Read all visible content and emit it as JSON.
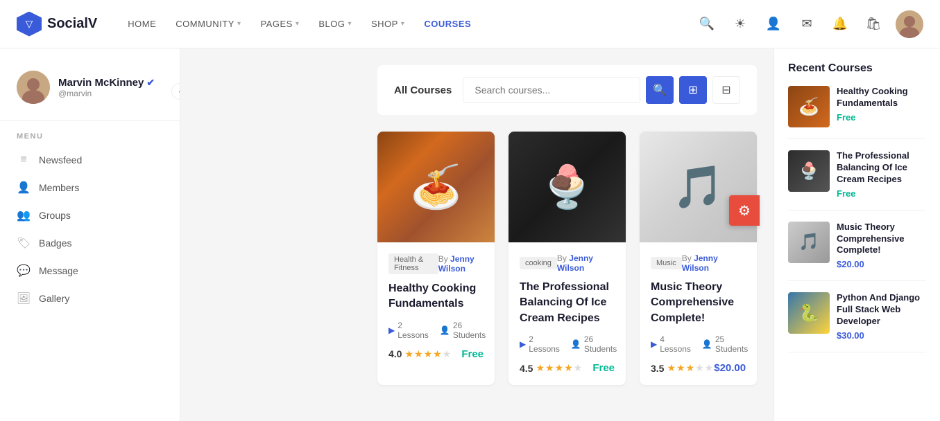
{
  "brand": {
    "name": "SocialV"
  },
  "nav": {
    "links": [
      {
        "id": "home",
        "label": "HOME",
        "active": false,
        "hasDropdown": false
      },
      {
        "id": "community",
        "label": "COMMUNITY",
        "active": false,
        "hasDropdown": true
      },
      {
        "id": "pages",
        "label": "PAGES",
        "active": false,
        "hasDropdown": true
      },
      {
        "id": "blog",
        "label": "BLOG",
        "active": false,
        "hasDropdown": true
      },
      {
        "id": "shop",
        "label": "SHOP",
        "active": false,
        "hasDropdown": true
      },
      {
        "id": "courses",
        "label": "COURSES",
        "active": true,
        "hasDropdown": false
      }
    ]
  },
  "user": {
    "name": "Marvin McKinney",
    "handle": "@marvin",
    "verified": true
  },
  "menu": {
    "label": "MENU",
    "items": [
      {
        "id": "newsfeed",
        "label": "Newsfeed",
        "icon": "≡"
      },
      {
        "id": "members",
        "label": "Members",
        "icon": "👤"
      },
      {
        "id": "groups",
        "label": "Groups",
        "icon": "👥"
      },
      {
        "id": "badges",
        "label": "Badges",
        "icon": "🏷"
      },
      {
        "id": "message",
        "label": "Message",
        "icon": "💬"
      },
      {
        "id": "gallery",
        "label": "Gallery",
        "icon": "🖼"
      }
    ]
  },
  "courses_page": {
    "header": {
      "all_courses_label": "All Courses",
      "search_placeholder": "Search courses...",
      "search_btn_label": "🔍",
      "grid_btn_label": "⊞",
      "filter_btn_label": "⊟"
    },
    "courses": [
      {
        "id": "course-1",
        "tag": "Health & Fitness",
        "author": "Jenny Wilson",
        "title": "Healthy Cooking Fundamentals",
        "lessons": "2 Lessons",
        "students": "26 Students",
        "rating": "4.0",
        "stars": "4",
        "price_label": "Free",
        "price_type": "free",
        "thumb_type": "pasta"
      },
      {
        "id": "course-2",
        "tag": "cooking",
        "author": "Jenny Wilson",
        "title": "The Professional Balancing Of Ice Cream Recipes",
        "lessons": "2 Lessons",
        "students": "26 Students",
        "rating": "4.5",
        "stars": "4.5",
        "price_label": "Free",
        "price_type": "free",
        "thumb_type": "icecream"
      },
      {
        "id": "course-3",
        "tag": "Music",
        "author": "Jenny Wilson",
        "title": "Music Theory Comprehensive Complete!",
        "lessons": "4 Lessons",
        "students": "25 Students",
        "rating": "3.5",
        "stars": "3.5",
        "price_label": "$20.00",
        "price_type": "paid",
        "thumb_type": "music"
      }
    ]
  },
  "recent_courses": {
    "title": "Recent Courses",
    "items": [
      {
        "id": "rc-1",
        "name": "Healthy Cooking Fundamentals",
        "price_label": "Free",
        "price_type": "free",
        "thumb_type": "pasta"
      },
      {
        "id": "rc-2",
        "name": "The Professional Balancing Of Ice Cream Recipes",
        "price_label": "Free",
        "price_type": "free",
        "thumb_type": "icecream"
      },
      {
        "id": "rc-3",
        "name": "Music Theory Comprehensive Complete!",
        "price_label": "$20.00",
        "price_type": "paid",
        "thumb_type": "music"
      },
      {
        "id": "rc-4",
        "name": "Python And Django Full Stack Web Developer",
        "price_label": "$30.00",
        "price_type": "paid",
        "thumb_type": "python"
      }
    ]
  }
}
